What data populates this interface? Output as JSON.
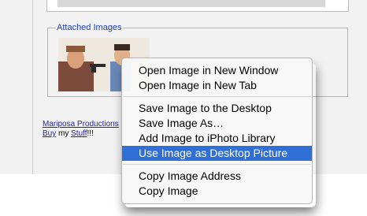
{
  "attached_images": {
    "legend": "Attached Images"
  },
  "footer": {
    "link1": "Mariposa Productions",
    "link2": "Buy",
    "text_my": " my ",
    "link3": "Stuff",
    "exclaim": "!!!"
  },
  "context_menu": {
    "groups": [
      [
        "Open Image in New Window",
        "Open Image in New Tab"
      ],
      [
        "Save Image to the Desktop",
        "Save Image As…",
        "Add Image to iPhoto Library",
        "Use Image as Desktop Picture"
      ],
      [
        "Copy Image Address",
        "Copy Image"
      ]
    ],
    "selected_item": "Use Image as Desktop Picture"
  },
  "colors": {
    "selection": "#2f6fd6",
    "link": "#1f1f9f",
    "legend": "#1f3fbf"
  }
}
